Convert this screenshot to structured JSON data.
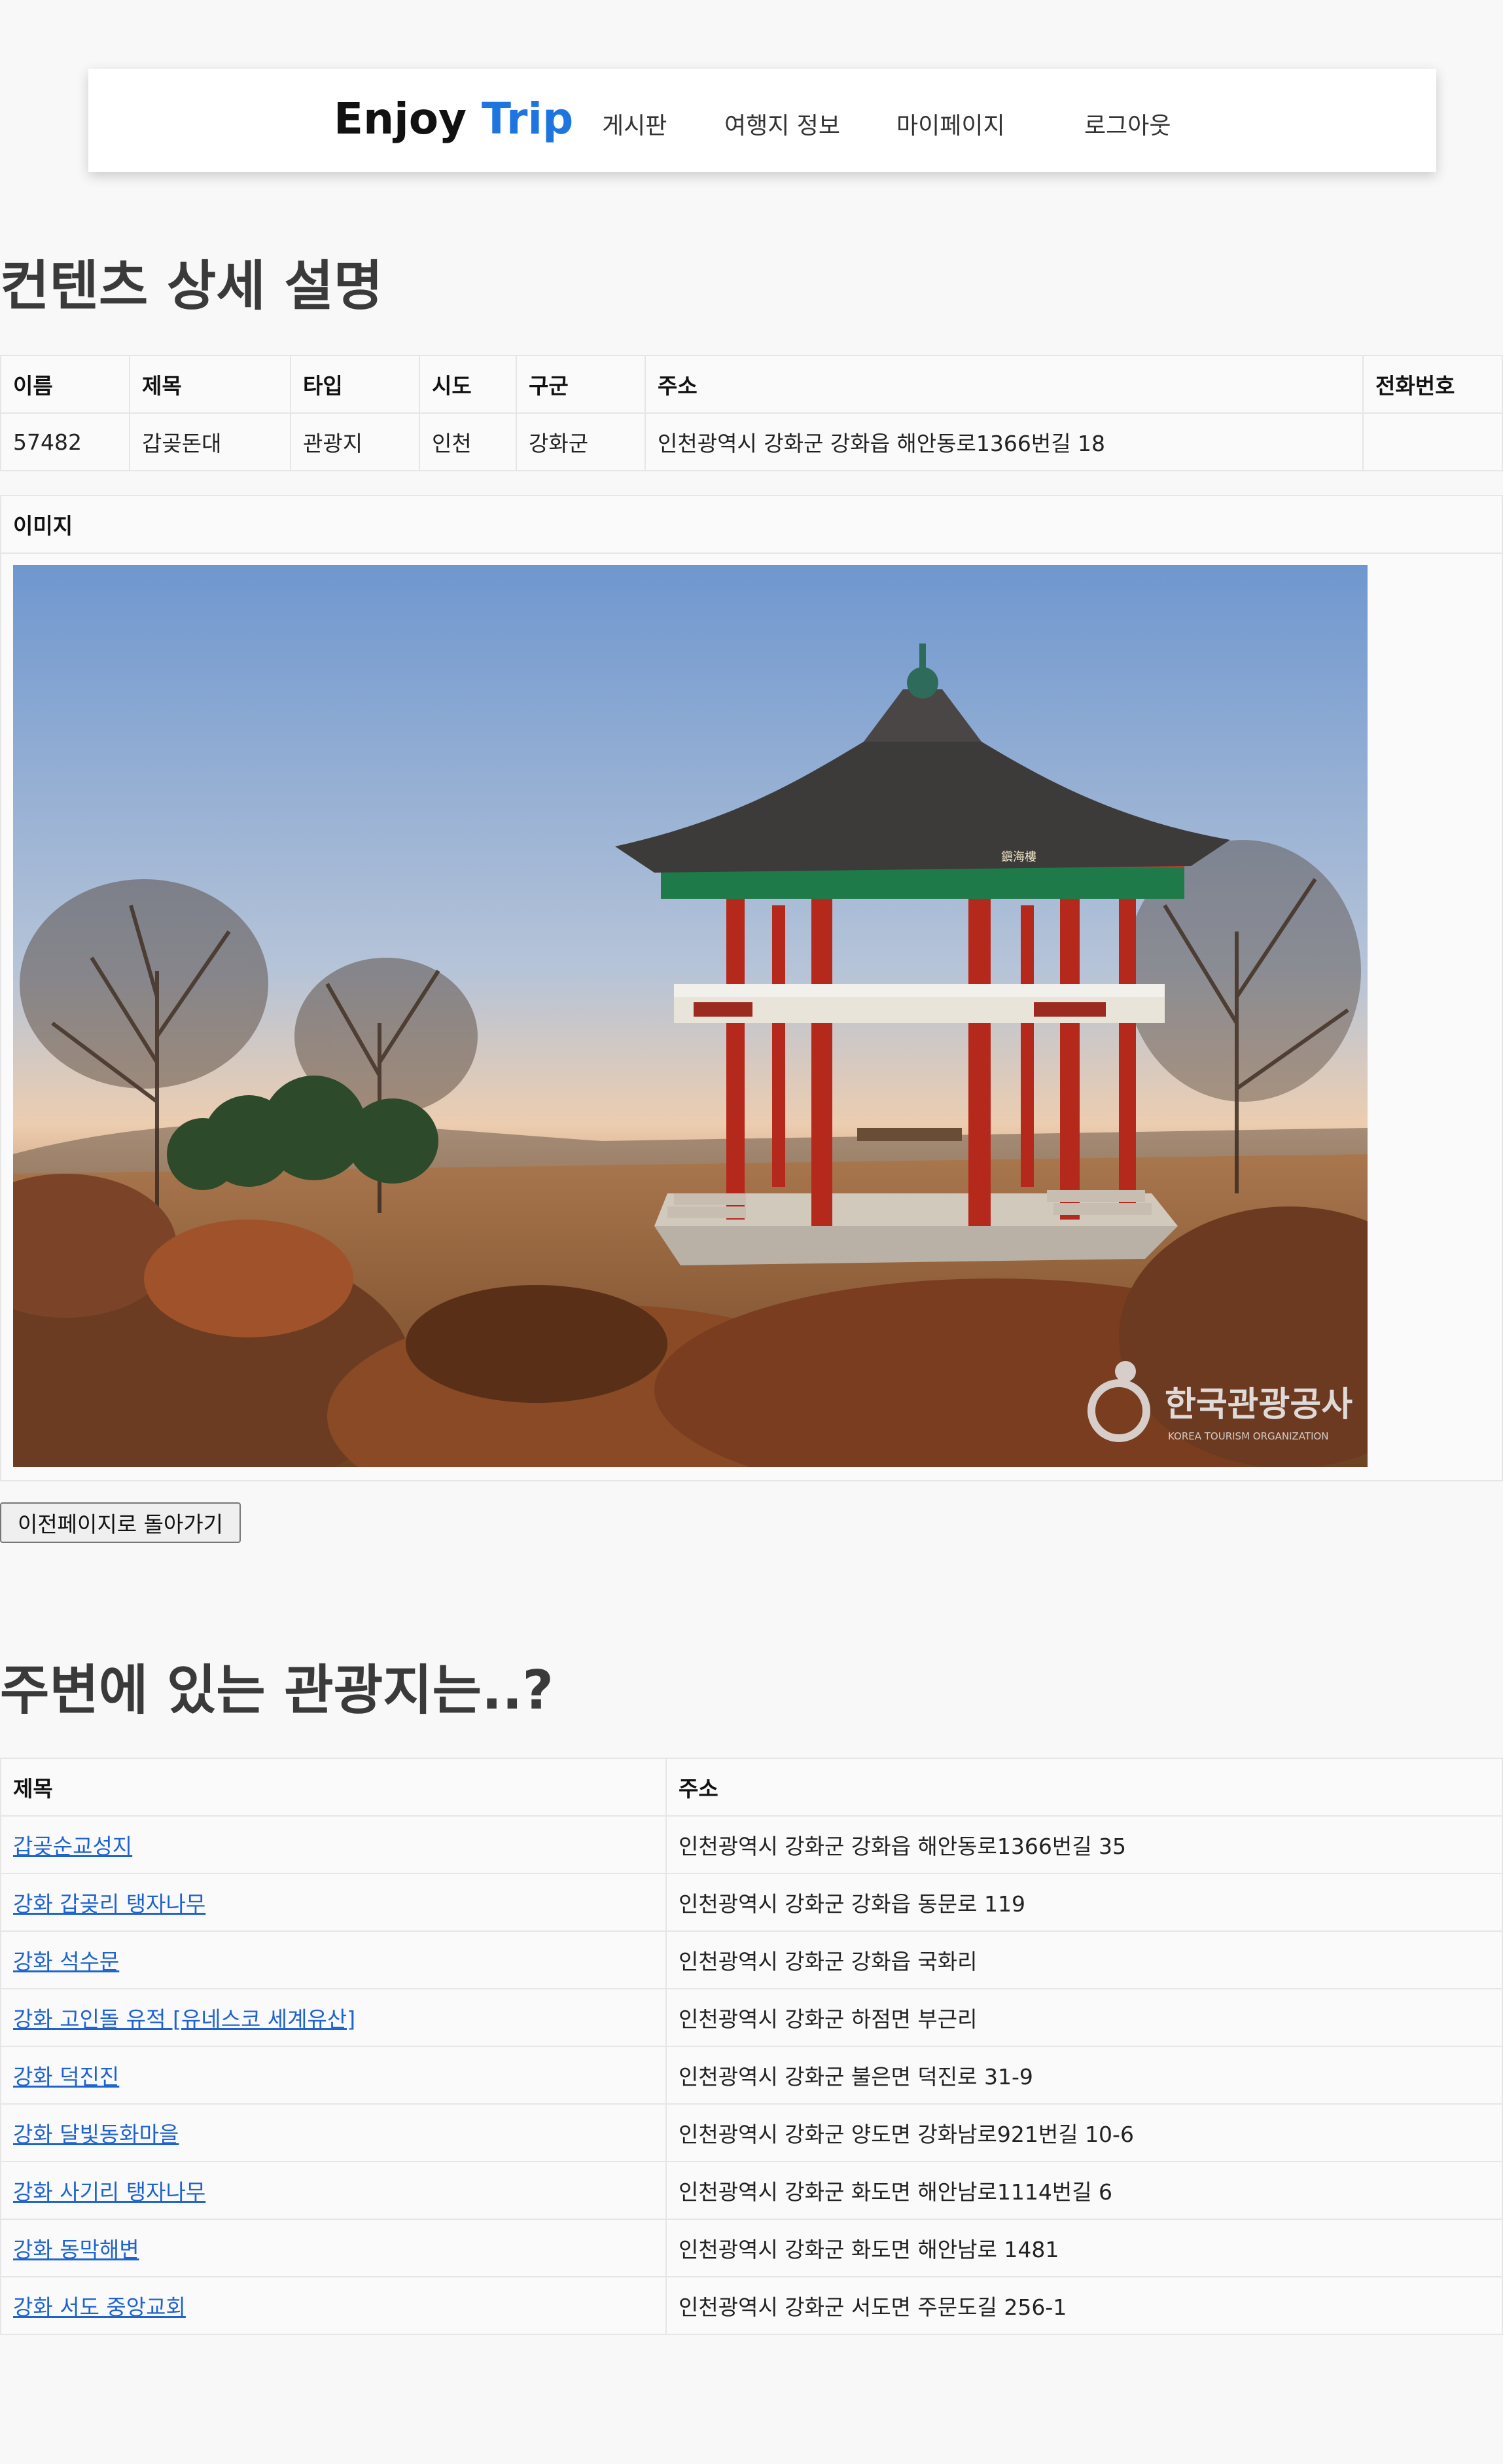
{
  "header": {
    "brand_primary": "Enjoy",
    "brand_accent": "Trip",
    "nav": {
      "board": "게시판",
      "travel_info": "여행지 정보",
      "mypage": "마이페이지",
      "logout": "로그아웃"
    }
  },
  "detail": {
    "title": "컨텐츠 상세 설명",
    "columns": [
      "이름",
      "제목",
      "타입",
      "시도",
      "구군",
      "주소",
      "전화번호"
    ],
    "row": [
      "57482",
      "갑곶돈대",
      "관광지",
      "인천",
      "강화군",
      "인천광역시 강화군 강화읍 해안동로1366번길 18",
      ""
    ]
  },
  "image_section": {
    "header": "이미지",
    "watermark_ko": "한국관광공사",
    "watermark_en": "KOREA TOURISM ORGANIZATION",
    "sign_text": "鎭海樓"
  },
  "back_button": "이전페이지로 돌아가기",
  "nearby": {
    "title": "주변에 있는 관광지는..?",
    "columns": [
      "제목",
      "주소"
    ],
    "rows": [
      [
        "갑곶순교성지",
        "인천광역시 강화군 강화읍 해안동로1366번길 35"
      ],
      [
        "강화 갑곶리 탱자나무",
        "인천광역시 강화군 강화읍 동문로 119"
      ],
      [
        "강화 석수문",
        "인천광역시 강화군 강화읍 국화리"
      ],
      [
        "강화 고인돌 유적 [유네스코 세계유산]",
        "인천광역시 강화군 하점면 부근리"
      ],
      [
        "강화 덕진진",
        "인천광역시 강화군 불은면 덕진로 31-9"
      ],
      [
        "강화 달빛동화마을",
        "인천광역시 강화군 양도면 강화남로921번길 10-6"
      ],
      [
        "강화 사기리 탱자나무",
        "인천광역시 강화군 화도면 해안남로1114번길 6"
      ],
      [
        "강화 동막해변",
        "인천광역시 강화군 화도면 해안남로 1481"
      ],
      [
        "강화 서도 중앙교회",
        "인천광역시 강화군 서도면 주문도길 256-1"
      ]
    ]
  }
}
